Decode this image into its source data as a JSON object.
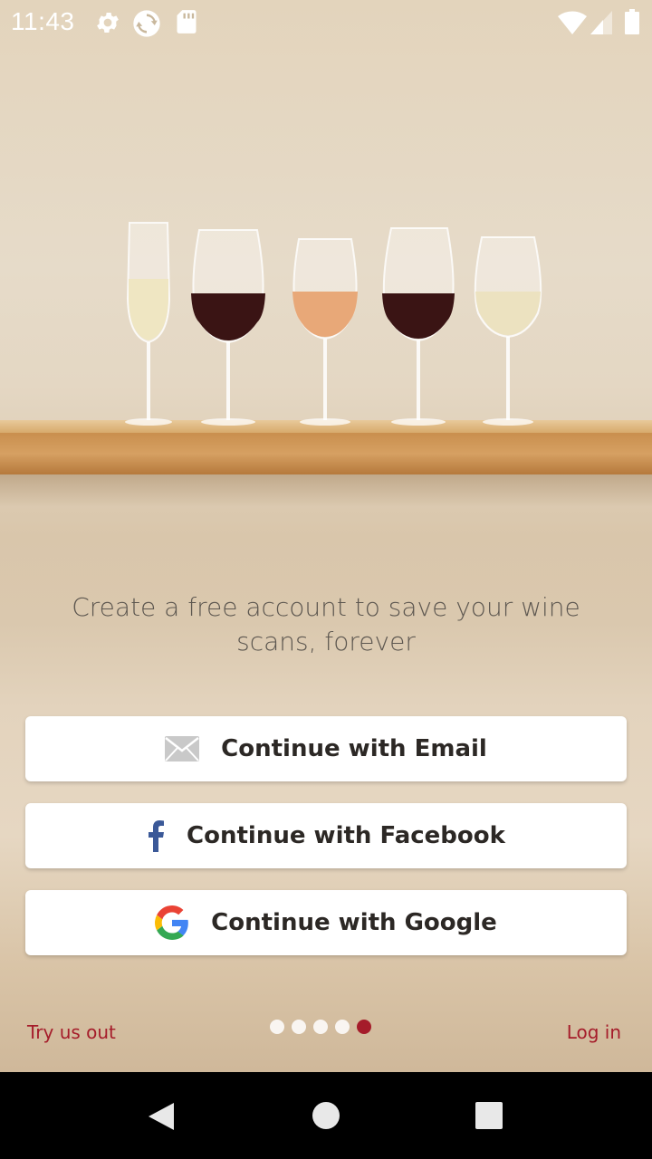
{
  "status_bar": {
    "time": "11:43",
    "icons": [
      "gear-icon",
      "sync-icon",
      "sd-card-icon",
      "wifi-icon",
      "cell-signal-icon",
      "battery-icon"
    ]
  },
  "hero": {
    "image": "wine-glasses-on-shelf",
    "glass_colors": [
      "#efe6c2",
      "#3a1414",
      "#e8a878",
      "#3a1414",
      "#ece2c0"
    ]
  },
  "headline": "Create a free account to save your wine scans, forever",
  "buttons": {
    "email": "Continue with Email",
    "facebook": "Continue with Facebook",
    "google": "Continue with Google"
  },
  "footer": {
    "try_label": "Try us out",
    "login_label": "Log in",
    "page_count": 5,
    "active_page": 5
  },
  "colors": {
    "accent": "#a51c2a",
    "facebook": "#3b5998"
  },
  "nav_bar": {
    "icons": [
      "back-icon",
      "home-icon",
      "recents-icon"
    ]
  }
}
